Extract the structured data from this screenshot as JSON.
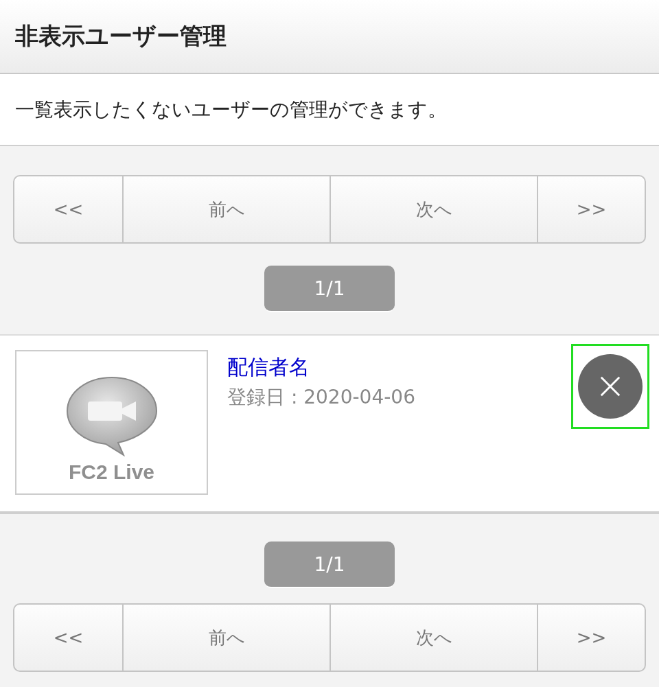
{
  "header": {
    "title": "非表示ユーザー管理"
  },
  "description": "一覧表示したくないユーザーの管理ができます。",
  "top_pager": {
    "buttons": [
      "<<",
      "前へ",
      "次へ",
      ">>"
    ],
    "page": "1/1"
  },
  "users": [
    {
      "thumbnail_caption": "FC2 Live",
      "name": "配信者名",
      "registered": "登録日 : 2020-04-06",
      "delete_highlighted": true
    }
  ],
  "bottom_pager": {
    "page": "1/1",
    "buttons": [
      "<<",
      "前へ",
      "次へ",
      ">>"
    ]
  }
}
